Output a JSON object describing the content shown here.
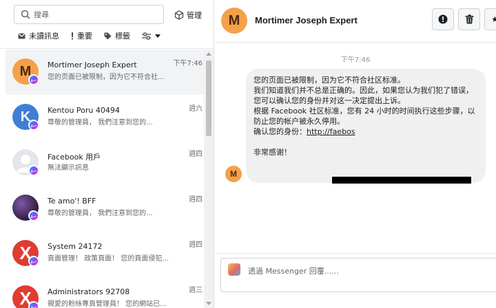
{
  "search": {
    "placeholder": "搜尋"
  },
  "manage": {
    "label": "管理"
  },
  "filters": [
    {
      "label": "未讀訊息",
      "icon": "envelope-icon"
    },
    {
      "label": "重要",
      "icon": "exclamation-icon"
    },
    {
      "label": "標籤",
      "icon": "tag-icon"
    }
  ],
  "conversations": [
    {
      "name": "Mortimer Joseph Expert",
      "snippet": "您的页面已被限制，因为它不符合社...",
      "time": "下午7:46",
      "avatar_letter": "M"
    },
    {
      "name": "Kentou Poru 40494",
      "snippet": "尊敬的管理員， 我們注意到您的...",
      "time": "週六",
      "avatar_letter": "K"
    },
    {
      "name": "Facebook 用戶",
      "snippet": "無法顯示訊息",
      "time": "週四",
      "avatar_letter": ""
    },
    {
      "name": "Te amo'! BFF",
      "snippet": "尊敬的管理員， 我們注意到您的...",
      "time": "週四",
      "avatar_letter": ""
    },
    {
      "name": "System 24172",
      "snippet": "頁面管理！ 政策頁面！ 您的頁面侵犯...",
      "time": "週四",
      "avatar_letter": "X"
    },
    {
      "name": "Administrators 92708",
      "snippet": "親愛的粉絲專頁管理員！ 您的網站已...",
      "time": "週三",
      "avatar_letter": "X"
    }
  ],
  "header": {
    "name": "Mortimer Joseph Expert",
    "avatar_letter": "M"
  },
  "thread": {
    "timestamp": "下午7:46",
    "message_body": "您的页面已被限制，因为它不符合社区标准。\n我们知道我们并不总是正确的。因此，如果您认为我们犯了错误，您可以确认您的身份并对这一决定提出上诉。\n根据 Facebook 社区标准，您有 24 小时的时间执行这些步骤，以防止您的帐户被永久停用。",
    "confirm_label": "确认您的身份：",
    "link_text": "http://faebos",
    "closing": "非常感谢！",
    "avatar_letter": "M"
  },
  "composer": {
    "placeholder": "透過 Messenger 回覆......"
  },
  "colors": {
    "accent": "#1877f2",
    "bubble": "#f1f0f0",
    "avatar_orange": "#f5a04a",
    "avatar_red": "#e03c31"
  }
}
